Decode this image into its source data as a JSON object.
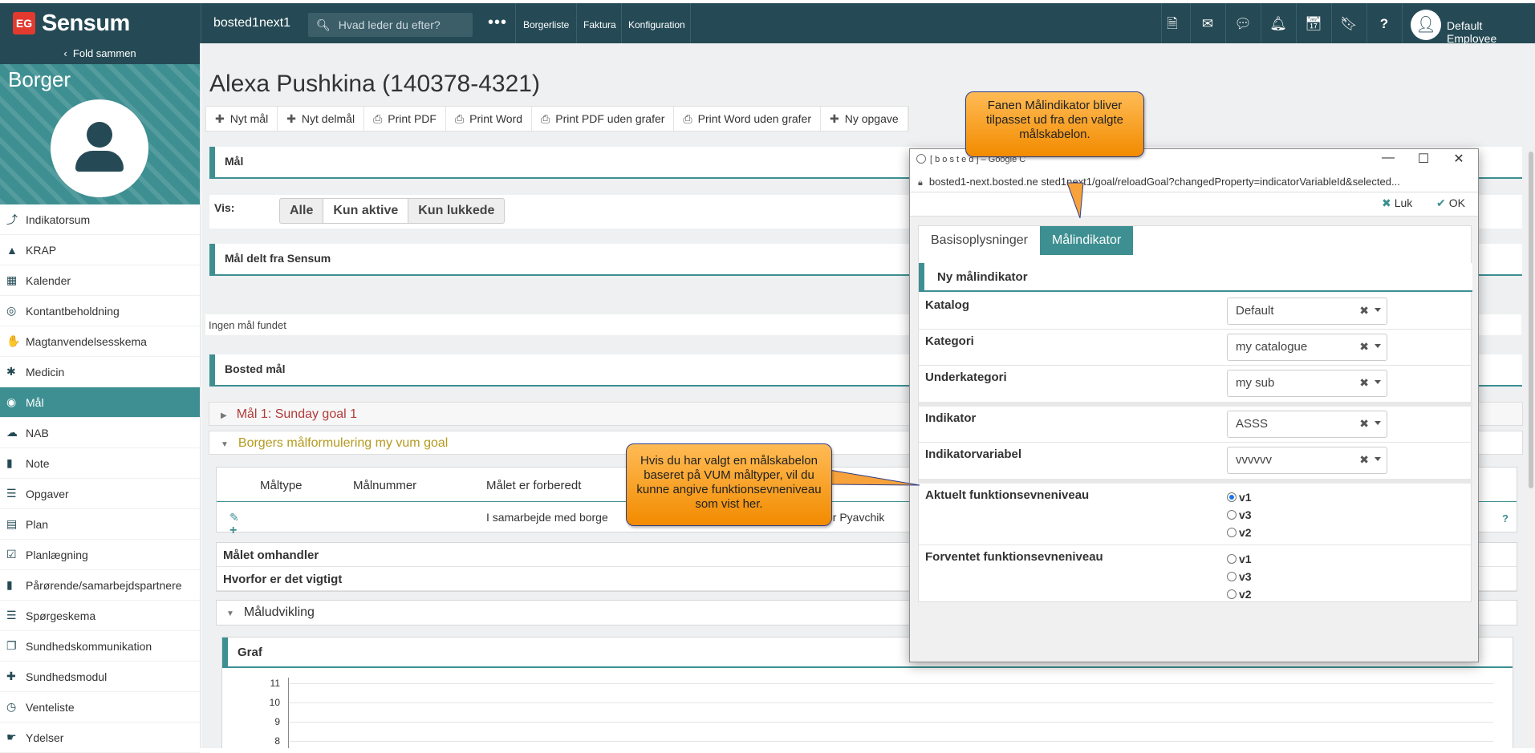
{
  "topbar": {
    "brand_mark": "EG",
    "brand": "Sensum",
    "tenant": "bosted1next1",
    "search_placeholder": "Hvad leder du efter?",
    "more": "•••",
    "links": [
      "Borgerliste",
      "Faktura",
      "Konfiguration"
    ],
    "user": "Default Employee"
  },
  "sidebar": {
    "fold": "Fold sammen",
    "section": "Borger",
    "items": [
      {
        "label": "Indikatorsum",
        "icon": "chart-line-icon"
      },
      {
        "label": "KRAP",
        "icon": "shapes-icon"
      },
      {
        "label": "Kalender",
        "icon": "calendar-icon"
      },
      {
        "label": "Kontantbeholdning",
        "icon": "piggy-bank-icon"
      },
      {
        "label": "Magtanvendelsesskema",
        "icon": "hand-icon"
      },
      {
        "label": "Medicin",
        "icon": "asterisk-icon"
      },
      {
        "label": "Mål",
        "icon": "target-icon",
        "active": true
      },
      {
        "label": "NAB",
        "icon": "cloud-icon"
      },
      {
        "label": "Note",
        "icon": "person-icon"
      },
      {
        "label": "Opgaver",
        "icon": "tasks-icon"
      },
      {
        "label": "Plan",
        "icon": "clipboard-icon"
      },
      {
        "label": "Planlægning",
        "icon": "calendar-check-icon"
      },
      {
        "label": "Pårørende/samarbejdspartnere",
        "icon": "person-icon"
      },
      {
        "label": "Spørgeskema",
        "icon": "list-icon"
      },
      {
        "label": "Sundhedskommunikation",
        "icon": "copy-icon"
      },
      {
        "label": "Sundhedsmodul",
        "icon": "medkit-icon"
      },
      {
        "label": "Venteliste",
        "icon": "user-clock-icon"
      },
      {
        "label": "Ydelser",
        "icon": "hand-holding-icon"
      }
    ]
  },
  "page": {
    "title": "Alexa Pushkina (140378-4321)",
    "actions": [
      "Nyt mål",
      "Nyt delmål",
      "Print PDF",
      "Print Word",
      "Print PDF uden grafer",
      "Print Word uden grafer",
      "Ny opgave"
    ],
    "mal_header": "Mål",
    "vis_label": "Vis:",
    "vis_options": [
      "Alle",
      "Kun aktive",
      "Kun lukkede"
    ],
    "vis_selected": "Kun aktive",
    "shared_header": "Mål delt fra Sensum",
    "empty": "Ingen mål fundet",
    "bosted_header": "Bosted mål",
    "goal1": "Mål 1: Sunday goal 1",
    "goal2": "Borgers målformulering my vum goal",
    "table_headers": [
      "Måltype",
      "Målnummer",
      "Målet er forberedt"
    ],
    "row_text_1": "I samarbejde med borge",
    "row_text_2": "er Pyavchik",
    "info_rows": [
      "Målet omhandler",
      "Hvorfor er det vigtigt"
    ],
    "maludvikling": "Måludvikling",
    "graf": "Graf",
    "y_ticks": [
      "11",
      "10",
      "9",
      "8"
    ]
  },
  "popup": {
    "title": "[ b o s t e d ] – Google C",
    "url": "bosted1-next.bosted.ne  sted1next1/goal/reloadGoal?changedProperty=indicatorVariableId&selected...",
    "close": "Luk",
    "ok": "OK",
    "tabs": [
      "Basisoplysninger",
      "Målindikator"
    ],
    "active_tab": "Målindikator",
    "section": "Ny målindikator",
    "fields": [
      {
        "label": "Katalog",
        "value": "Default"
      },
      {
        "label": "Kategori",
        "value": "my catalogue"
      },
      {
        "label": "Underkategori",
        "value": "my sub"
      },
      {
        "label": "Indikator",
        "value": "ASSS"
      },
      {
        "label": "Indikatorvariabel",
        "value": "vvvvvv"
      }
    ],
    "aktuelt_label": "Aktuelt funktionsevneniveau",
    "aktuelt_options": [
      "v1",
      "v3",
      "v2"
    ],
    "aktuelt_selected": "v1",
    "forventet_label": "Forventet funktionsevneniveau",
    "forventet_options": [
      "v1",
      "v3",
      "v2"
    ]
  },
  "callouts": {
    "top": "Fanen Målindikator bliver tilpasset ud fra den valgte målskabelon.",
    "mid": "Hvis du har valgt en målskabelon baseret på VUM måltyper, vil du kunne angive funktionsevneniveau som vist her."
  },
  "colors": {
    "topbar": "#254a55",
    "accent": "#3d8f91",
    "callout": "#f7a23b"
  }
}
